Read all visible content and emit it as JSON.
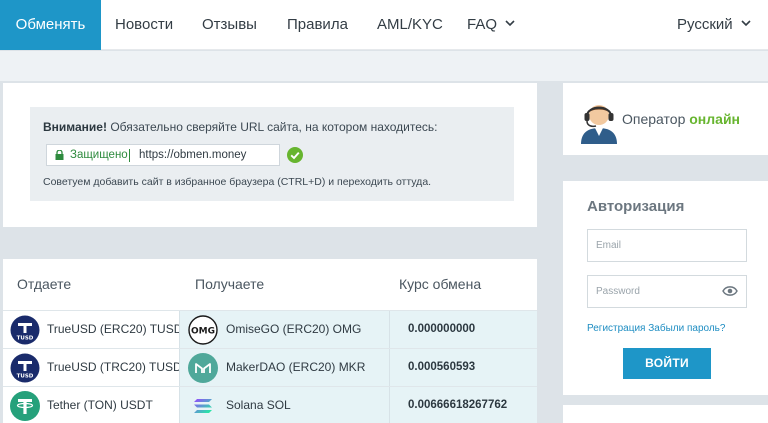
{
  "nav": {
    "items": [
      {
        "label": "Обменять",
        "active": true
      },
      {
        "label": "Новости"
      },
      {
        "label": "Отзывы"
      },
      {
        "label": "Правила"
      },
      {
        "label": "AML/KYC"
      },
      {
        "label": "FAQ",
        "dropdown": true
      }
    ],
    "language": "Русский",
    "accent_color": "#1e96c8"
  },
  "notice": {
    "title_bold": "Внимание!",
    "title_rest": " Обязательно сверяйте URL сайта, на котором находитесь:",
    "secure_label": "Защищено",
    "url": "https://obmen.money",
    "hint": "Советуем добавить сайт в избранное браузера (CTRL+D) и переходить оттуда."
  },
  "table": {
    "headers": {
      "give": "Отдаете",
      "get": "Получаете",
      "rate": "Курс обмена"
    },
    "rows": [
      {
        "give_icon": "tusd-icon",
        "give": "TrueUSD (ERC20) TUSD",
        "get_icon": "omg-icon",
        "get": "OmiseGO (ERC20) OMG",
        "rate": "0.000000000"
      },
      {
        "give_icon": "tusd-icon",
        "give": "TrueUSD (TRC20) TUSD",
        "get_icon": "mkr-icon",
        "get": "MakerDAO (ERC20) MKR",
        "rate": "0.000560593"
      },
      {
        "give_icon": "usdt-icon",
        "give": "Tether (TON) USDT",
        "get_icon": "sol-icon",
        "get": "Solana SOL",
        "rate": "0.00666618267762"
      }
    ]
  },
  "operator": {
    "label": "Оператор",
    "status": "онлайн",
    "status_color": "#67b52f"
  },
  "auth": {
    "title": "Авторизация",
    "email_placeholder": "Email",
    "password_placeholder": "Password",
    "register_link": "Регистрация",
    "forgot_link": "Забыли пароль?",
    "login_button": "ВОЙТИ"
  }
}
